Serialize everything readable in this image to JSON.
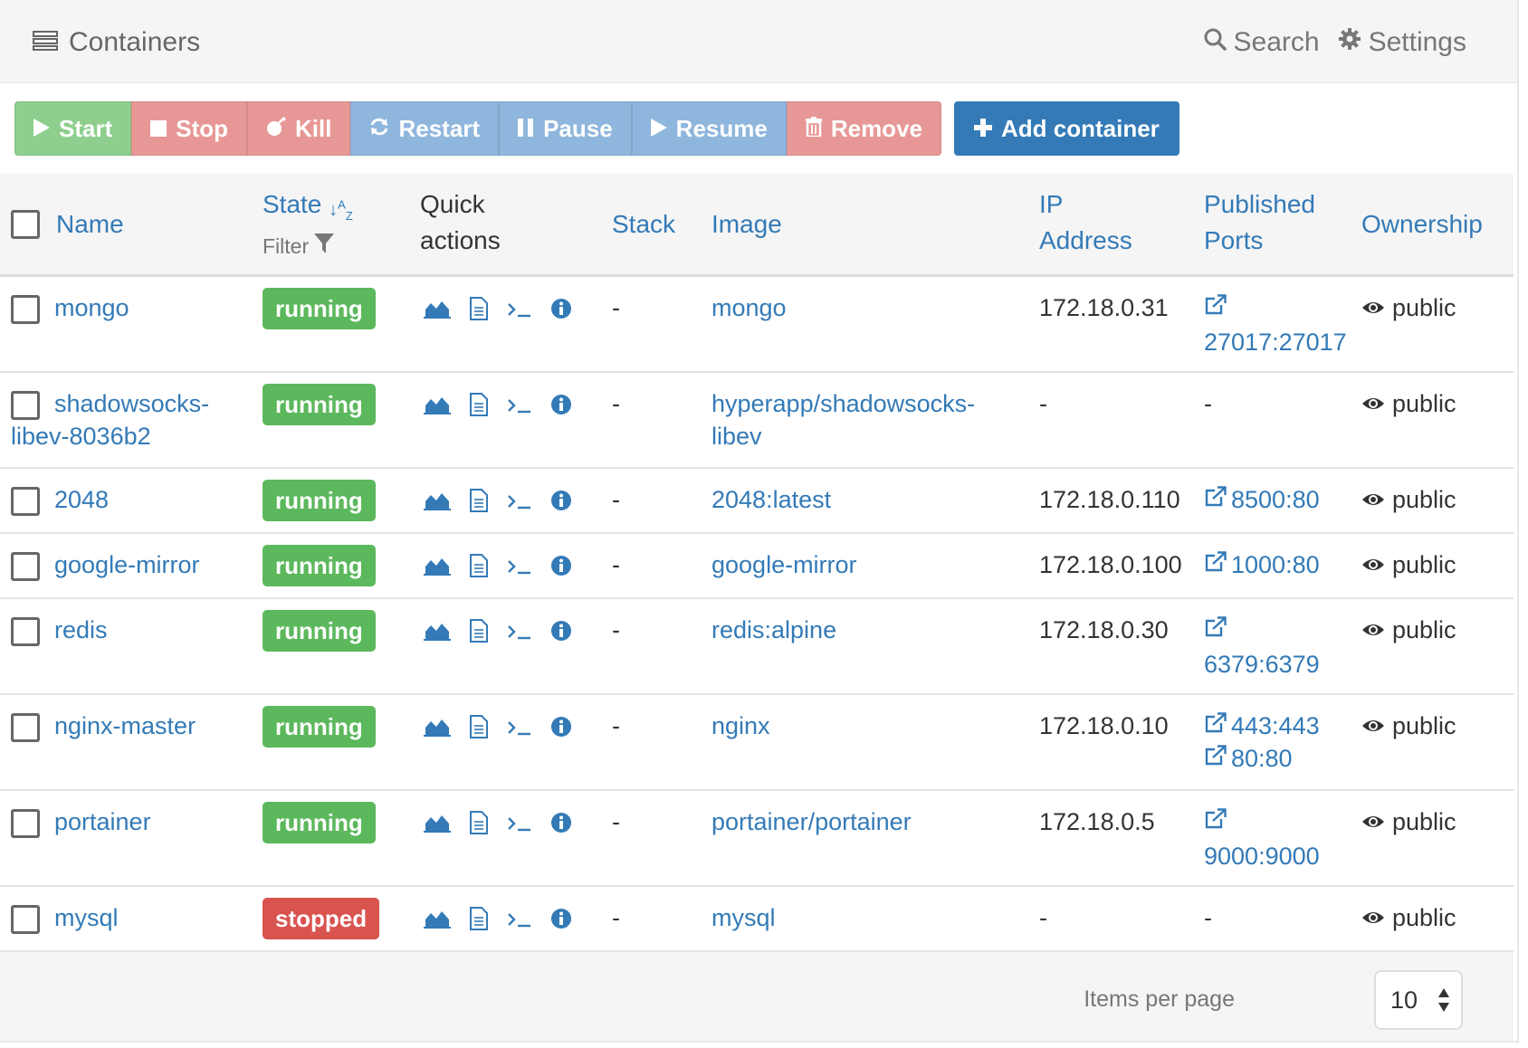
{
  "header": {
    "title": "Containers",
    "search_label": "Search",
    "settings_label": "Settings"
  },
  "toolbar": {
    "start": "Start",
    "stop": "Stop",
    "kill": "Kill",
    "restart": "Restart",
    "pause": "Pause",
    "resume": "Resume",
    "remove": "Remove",
    "add": "Add container"
  },
  "table": {
    "columns": {
      "name": "Name",
      "state": "State",
      "filter": "Filter",
      "quick_1": "Quick",
      "quick_2": "actions",
      "stack": "Stack",
      "image": "Image",
      "ip_1": "IP",
      "ip_2": "Address",
      "ports_1": "Published",
      "ports_2": "Ports",
      "ownership": "Ownership"
    },
    "rows": [
      {
        "name_1": "mongo",
        "name_2": "",
        "state": "running",
        "stack": "-",
        "image_1": "mongo",
        "image_2": "",
        "ip": "172.18.0.31",
        "port_1": "27017:27017",
        "port_2": "",
        "ownership": "public"
      },
      {
        "name_1": "shadowsocks-",
        "name_2": "libev-8036b2",
        "state": "running",
        "stack": "-",
        "image_1": "hyperapp/shadowsocks-",
        "image_2": "libev",
        "ip": "-",
        "port_1": "-",
        "port_2": "",
        "ownership": "public"
      },
      {
        "name_1": "2048",
        "name_2": "",
        "state": "running",
        "stack": "-",
        "image_1": "2048:latest",
        "image_2": "",
        "ip": "172.18.0.110",
        "port_1": "8500:80",
        "port_2": "",
        "ownership": "public"
      },
      {
        "name_1": "google-mirror",
        "name_2": "",
        "state": "running",
        "stack": "-",
        "image_1": "google-mirror",
        "image_2": "",
        "ip": "172.18.0.100",
        "port_1": "1000:80",
        "port_2": "",
        "ownership": "public"
      },
      {
        "name_1": "redis",
        "name_2": "",
        "state": "running",
        "stack": "-",
        "image_1": "redis:alpine",
        "image_2": "",
        "ip": "172.18.0.30",
        "port_1": "6379:6379",
        "port_2": "",
        "ownership": "public"
      },
      {
        "name_1": "nginx-master",
        "name_2": "",
        "state": "running",
        "stack": "-",
        "image_1": "nginx",
        "image_2": "",
        "ip": "172.18.0.10",
        "port_1": "443:443",
        "port_2": "80:80",
        "ownership": "public"
      },
      {
        "name_1": "portainer",
        "name_2": "",
        "state": "running",
        "stack": "-",
        "image_1": "portainer/portainer",
        "image_2": "",
        "ip": "172.18.0.5",
        "port_1": "9000:9000",
        "port_2": "",
        "ownership": "public"
      },
      {
        "name_1": "mysql",
        "name_2": "",
        "state": "stopped",
        "stack": "-",
        "image_1": "mysql",
        "image_2": "",
        "ip": "-",
        "port_1": "-",
        "port_2": "",
        "ownership": "public"
      }
    ]
  },
  "footer": {
    "items_per_page_label": "Items per page",
    "items_per_page_value": "10"
  }
}
